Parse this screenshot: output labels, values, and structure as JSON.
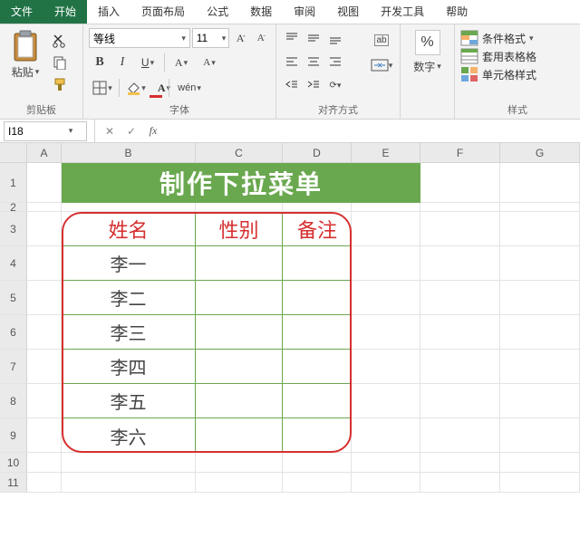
{
  "tabs": {
    "file": "文件",
    "home": "开始",
    "insert": "插入",
    "layout": "页面布局",
    "formula": "公式",
    "data": "数据",
    "review": "审阅",
    "view": "视图",
    "dev": "开发工具",
    "help": "帮助"
  },
  "ribbon": {
    "clipboard": {
      "label": "剪贴板",
      "paste": "粘贴"
    },
    "font": {
      "label": "字体",
      "name": "等线",
      "size": "11",
      "bold": "B",
      "italic": "I",
      "underline": "U",
      "increase": "A",
      "decrease": "A",
      "wen": "wén"
    },
    "align": {
      "label": "对齐方式",
      "ab": "ab"
    },
    "number": {
      "label": "数字",
      "symbol": "%"
    },
    "styles": {
      "label": "样式",
      "conditional": "条件格式",
      "tableformat": "套用表格格",
      "cellstyle": "单元格样式"
    }
  },
  "namebox": {
    "value": "I18"
  },
  "fx": {
    "label": "fx",
    "value": ""
  },
  "columns": [
    "A",
    "B",
    "C",
    "D",
    "E",
    "F",
    "G"
  ],
  "rows": [
    "1",
    "2",
    "3",
    "4",
    "5",
    "6",
    "7",
    "8",
    "9",
    "10",
    "11"
  ],
  "banner_title": "制作下拉菜单",
  "table": {
    "headers": {
      "name": "姓名",
      "gender": "性别",
      "note": "备注"
    },
    "rows": [
      "李一",
      "李二",
      "李三",
      "李四",
      "李五",
      "李六"
    ]
  }
}
